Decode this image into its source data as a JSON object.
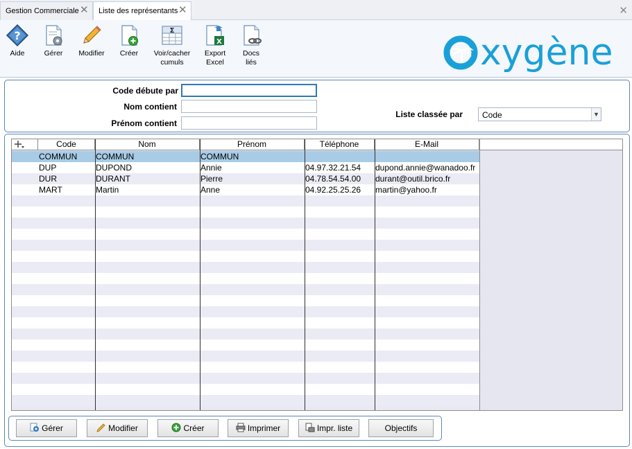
{
  "tabs": [
    {
      "label": "Gestion Commerciale",
      "active": false
    },
    {
      "label": "Liste des représentants",
      "active": true
    }
  ],
  "toolbar": {
    "aide": "Aide",
    "gerer": "Gérer",
    "modifier": "Modifier",
    "creer": "Créer",
    "cumuls_1": "Voir/cacher",
    "cumuls_2": "cumuls",
    "export_1": "Export",
    "export_2": "Excel",
    "docs_1": "Docs",
    "docs_2": "liés"
  },
  "logo": {
    "text": "oxygène",
    "color": "#1aa0d8"
  },
  "filter": {
    "code_label": "Code débute par",
    "code_value": "",
    "nom_label": "Nom contient",
    "nom_value": "",
    "prenom_label": "Prénom contient",
    "prenom_value": "",
    "sort_label": "Liste classée par",
    "sort_value": "Code"
  },
  "grid": {
    "headers": {
      "code": "Code",
      "nom": "Nom",
      "prenom": "Prénom",
      "telephone": "Téléphone",
      "email": "E-Mail"
    },
    "rows": [
      {
        "code": "COMMUN",
        "nom": "COMMUN",
        "prenom": "COMMUN",
        "telephone": "",
        "email": ""
      },
      {
        "code": "DUP",
        "nom": "DUPOND",
        "prenom": "Annie",
        "telephone": "04.97.32.21.54",
        "email": "dupond.annie@wanadoo.fr"
      },
      {
        "code": "DUR",
        "nom": "DURANT",
        "prenom": "Pierre",
        "telephone": "04.78.54.54.00",
        "email": "durant@outil.brico.fr"
      },
      {
        "code": "MART",
        "nom": "Martin",
        "prenom": "Anne",
        "telephone": "04.92.25.25.26",
        "email": "martin@yahoo.fr"
      }
    ],
    "selected_color": "#a8cbe6"
  },
  "buttons": {
    "gerer": "Gérer",
    "modifier": "Modifier",
    "creer": "Créer",
    "imprimer": "Imprimer",
    "impr_liste": "Impr. liste",
    "objectifs": "Objectifs"
  }
}
